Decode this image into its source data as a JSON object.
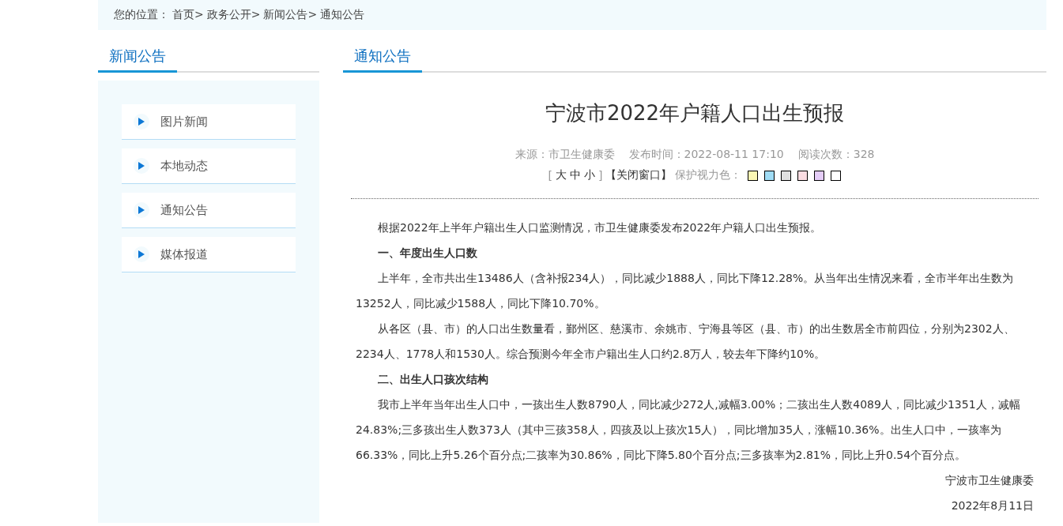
{
  "breadcrumb": {
    "label": "您的位置：",
    "items": [
      "首页>",
      "政务公开>",
      "新闻公告>",
      "通知公告"
    ]
  },
  "sidebar": {
    "title": "新闻公告",
    "items": [
      {
        "label": "图片新闻"
      },
      {
        "label": "本地动态"
      },
      {
        "label": "通知公告"
      },
      {
        "label": "媒体报道"
      }
    ]
  },
  "main": {
    "section_title": "通知公告",
    "article": {
      "title": "宁波市2022年户籍人口出生预报",
      "meta": [
        "来源：市卫生健康委",
        "发布时间：2022-08-11 17:10",
        "阅读次数：328"
      ],
      "font_size": {
        "open": "[",
        "options": [
          "大",
          "中",
          "小"
        ],
        "close": "]"
      },
      "close_window": "【关闭窗口】",
      "eye_care": {
        "label": "保护视力色：",
        "swatches": [
          {
            "color": "#faf6b4"
          },
          {
            "color": "#a0dcf5"
          },
          {
            "color": "#e0e0e0"
          },
          {
            "color": "#fadce2"
          },
          {
            "color": "#e4ccf7"
          },
          {
            "color": "#ffffff"
          }
        ]
      },
      "paragraphs": [
        {
          "kind": "text",
          "text": "根据2022年上半年户籍出生人口监测情况，市卫生健康委发布2022年户籍人口出生预报。"
        },
        {
          "kind": "heading",
          "text": "一、年度出生人口数"
        },
        {
          "kind": "text",
          "text": "上半年，全市共出生13486人（含补报234人），同比减少1888人，同比下降12.28%。从当年出生情况来看，全市半年出生数为13252人，同比减少1588人，同比下降10.70%。"
        },
        {
          "kind": "text",
          "text": "从各区（县、市）的人口出生数量看，鄞州区、慈溪市、余姚市、宁海县等区（县、市）的出生数居全市前四位，分别为2302人、2234人、1778人和1530人。综合预测今年全市户籍出生人口约2.8万人，较去年下降约10%。"
        },
        {
          "kind": "heading",
          "text": "二、出生人口孩次结构"
        },
        {
          "kind": "text",
          "text": "我市上半年当年出生人口中，一孩出生人数8790人，同比减少272人,减幅3.00%；二孩出生人数4089人，同比减少1351人，减幅24.83%;三多孩出生人数373人（其中三孩358人，四孩及以上孩次15人），同比增加35人，涨幅10.36%。出生人口中，一孩率为66.33%，同比上升5.26个百分点;二孩率为30.86%，同比下降5.80个百分点;三多孩率为2.81%，同比上升0.54个百分点。"
        },
        {
          "kind": "signature",
          "text": "宁波市卫生健康委"
        },
        {
          "kind": "signature",
          "text": "2022年8月11日"
        }
      ]
    }
  }
}
